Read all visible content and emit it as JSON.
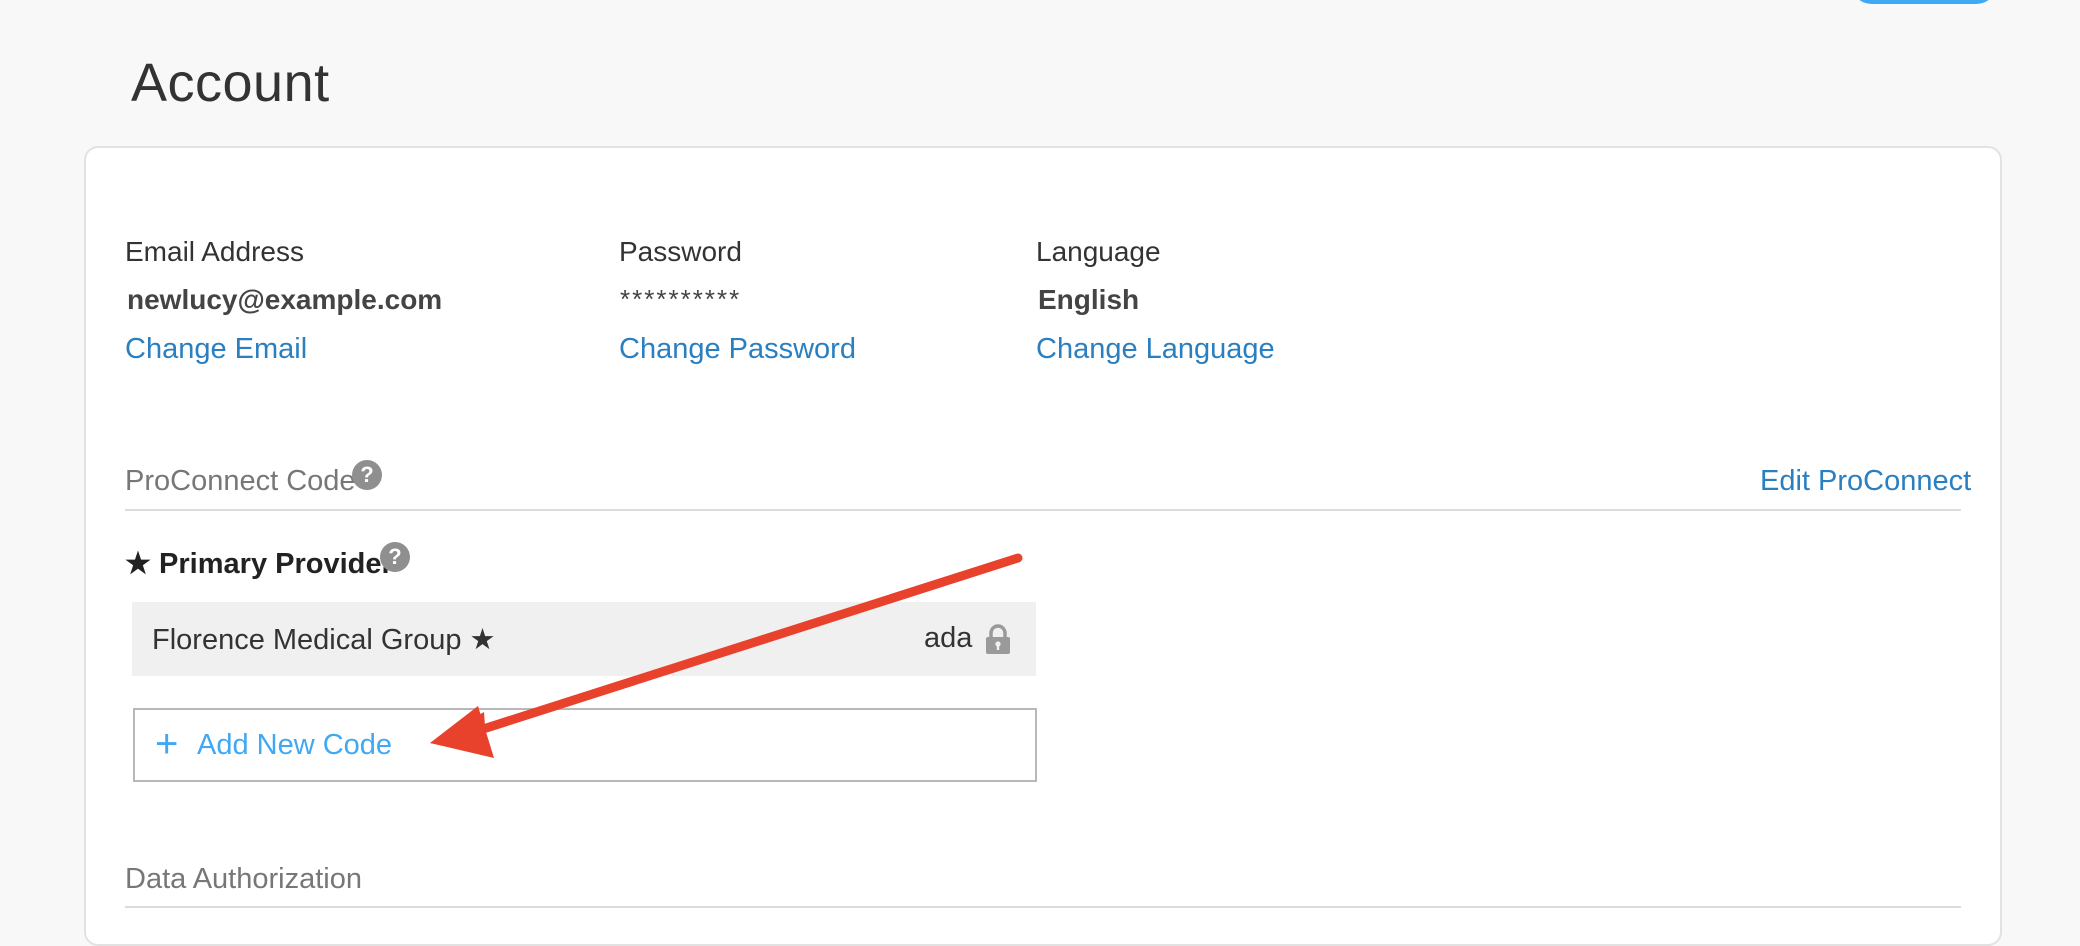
{
  "page": {
    "title": "Account"
  },
  "account": {
    "email": {
      "label": "Email Address",
      "value": "newlucy@example.com",
      "link": "Change Email"
    },
    "password": {
      "label": "Password",
      "value": "**********",
      "link": "Change Password"
    },
    "language": {
      "label": "Language",
      "value": "English",
      "link": "Change Language"
    }
  },
  "proconnect": {
    "label": "ProConnect Code",
    "help": "?",
    "edit_link": "Edit ProConnect",
    "primary_heading": "★ Primary Provider",
    "primary_help": "?",
    "provider": {
      "name": "Florence Medical Group ★",
      "code": "ada"
    },
    "add_button": {
      "icon": "+",
      "label": "Add New Code"
    }
  },
  "data_authorization": {
    "label": "Data Authorization"
  },
  "colors": {
    "link": "#2a7fc1",
    "accent": "#3fa9f5",
    "arrow": "#e8412c",
    "help_icon": "#8f8f8f"
  }
}
